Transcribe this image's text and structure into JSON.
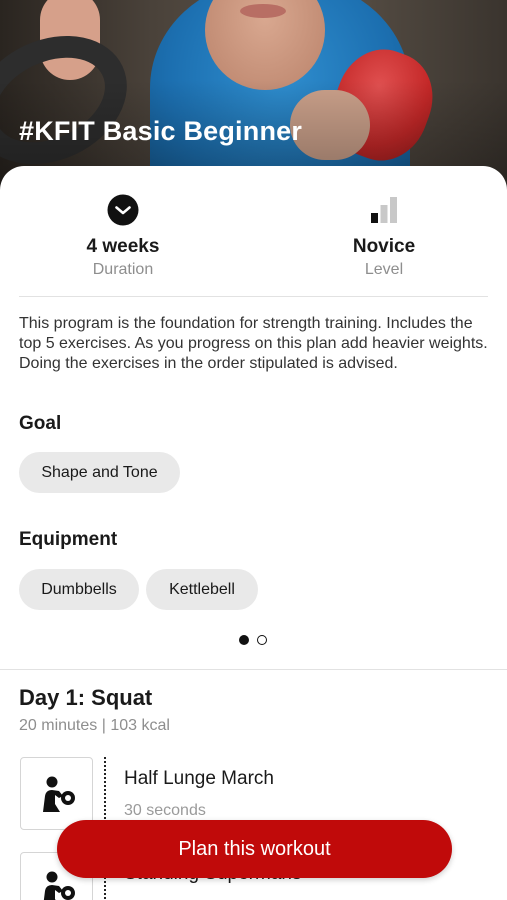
{
  "program": {
    "title": "#KFIT Basic Beginner",
    "description": "This program is the foundation for strength training. Includes the top 5 exercises. As you progress on this plan add heavier weights. Doing the exercises in the order stipulated is advised."
  },
  "stats": {
    "duration": {
      "value": "4 weeks",
      "label": "Duration",
      "icon": "clock-icon"
    },
    "level": {
      "value": "Novice",
      "label": "Level",
      "icon": "signal-bars-icon"
    }
  },
  "goal": {
    "heading": "Goal",
    "chips": [
      "Shape and Tone"
    ]
  },
  "equipment": {
    "heading": "Equipment",
    "chips": [
      "Dumbbells",
      "Kettlebell"
    ]
  },
  "pager": {
    "pages": 2,
    "active_index": 0
  },
  "day": {
    "title": "Day 1: Squat",
    "meta": "20 minutes | 103 kcal",
    "exercises": [
      {
        "name": "Half Lunge March",
        "duration": "30 seconds",
        "icon": "weightlifter-icon"
      },
      {
        "name": "Standing Supermans",
        "icon": "weightlifter-icon"
      }
    ]
  },
  "cta": {
    "label": "Plan this workout"
  },
  "colors": {
    "accent": "#c00a0a",
    "chip_bg": "#e9e9e9",
    "muted_text": "#8e8e8e"
  }
}
